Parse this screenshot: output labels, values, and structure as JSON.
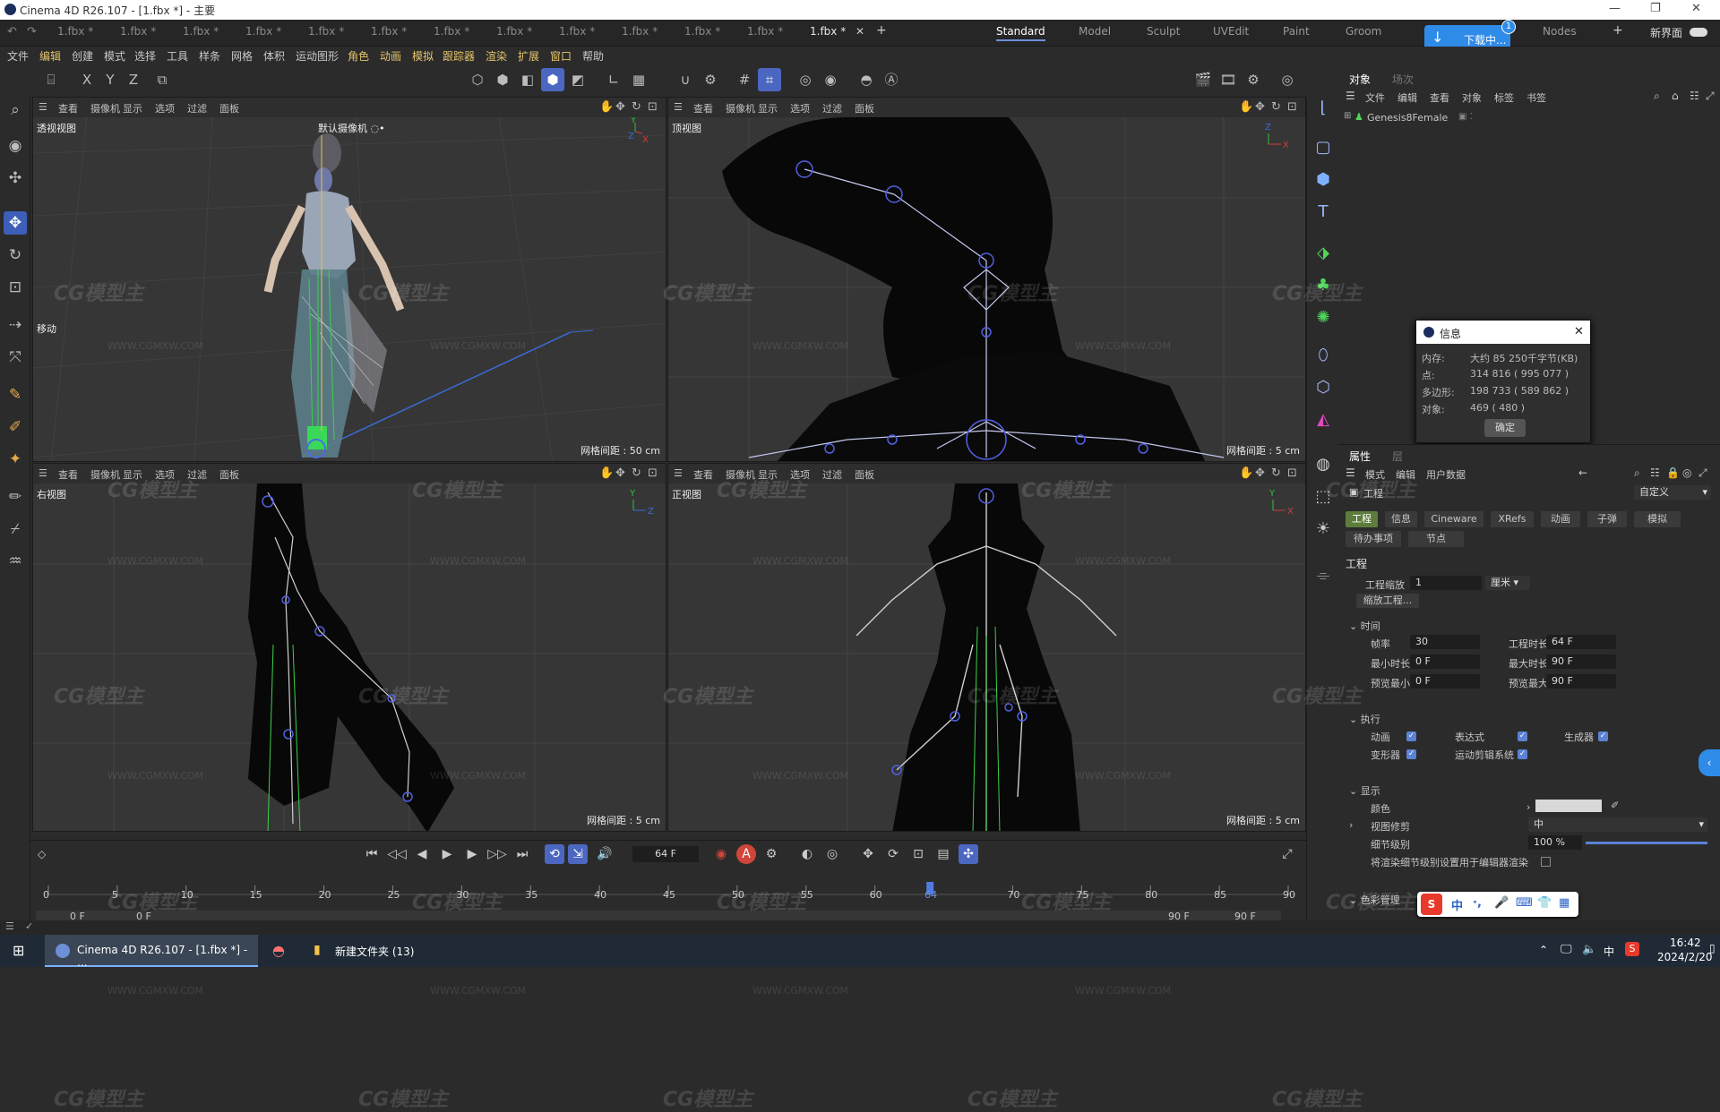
{
  "window": {
    "title": "Cinema 4D R26.107 - [1.fbx *] - 主要",
    "minimize": "—",
    "restore": "❐",
    "close": "✕"
  },
  "file_tabs": [
    "1.fbx *",
    "1.fbx *",
    "1.fbx *",
    "1.fbx *",
    "1.fbx *",
    "1.fbx *",
    "1.fbx *",
    "1.fbx *",
    "1.fbx *",
    "1.fbx *",
    "1.fbx *",
    "1.fbx *",
    "1.fbx *"
  ],
  "layouts": [
    "Standard",
    "Model",
    "Sculpt",
    "UVEdit",
    "Paint",
    "Groom",
    "Nodes"
  ],
  "new_layout": "新界面",
  "download": {
    "label": "下载中...",
    "badge": "1"
  },
  "menu": [
    "文件",
    "编辑",
    "创建",
    "模式",
    "选择",
    "工具",
    "样条",
    "网格",
    "体积",
    "运动图形",
    "角色",
    "动画",
    "模拟",
    "跟踪器",
    "渲染",
    "扩展",
    "窗口",
    "帮助"
  ],
  "axes": [
    "X",
    "Y",
    "Z"
  ],
  "viewport_menu": [
    "查看",
    "摄像机",
    "显示",
    "选项",
    "过滤",
    "面板"
  ],
  "viewports": {
    "perspective": {
      "name": "透视视图",
      "camera": "默认摄像机 ◌•",
      "grid": "网格间距 : 50 cm",
      "move_label": "移动"
    },
    "top": {
      "name": "顶视图",
      "grid": "网格间距 : 5 cm"
    },
    "right": {
      "name": "右视图",
      "grid": "网格间距 : 5 cm"
    },
    "front": {
      "name": "正视图",
      "grid": "网格间距 : 5 cm"
    }
  },
  "object_panel": {
    "tabs": [
      "对象",
      "场次"
    ],
    "menu": [
      "文件",
      "编辑",
      "查看",
      "对象",
      "标签",
      "书签"
    ],
    "object": "Genesis8Female"
  },
  "info_dialog": {
    "title": "信息",
    "rows": [
      {
        "label": "内存:",
        "value": "大约 85 250千字节(KB)"
      },
      {
        "label": "点:",
        "value": "314 816 ( 995 077 )"
      },
      {
        "label": "多边形:",
        "value": "198 733 ( 589 862 )"
      },
      {
        "label": "对象:",
        "value": "469 ( 480 )"
      }
    ],
    "ok": "确定"
  },
  "attr_panel": {
    "tabs": [
      "属性",
      "层"
    ],
    "menu": [
      "模式",
      "编辑",
      "用户数据"
    ],
    "header": "工程",
    "preset": "自定义",
    "subtabs": [
      "工程",
      "信息",
      "Cineware",
      "XRefs",
      "动画",
      "子弹",
      "模拟"
    ],
    "subtabs2": [
      "待办事项",
      "节点"
    ],
    "section": "工程",
    "project_scale_label": "工程缩放",
    "project_scale": "1",
    "project_scale_unit": "厘米",
    "scale_project_btn": "缩放工程...",
    "time_group": "时间",
    "fps_label": "帧率",
    "fps": "30",
    "project_time_label": "工程时长",
    "project_time": "64 F",
    "min_time_label": "最小时长",
    "min_time": "0 F",
    "max_time_label": "最大时长",
    "max_time": "90 F",
    "preview_min_label": "预览最小",
    "preview_min": "0 F",
    "preview_max_label": "预览最大",
    "preview_max": "90 F",
    "exec_group": "执行",
    "exec": [
      "动画",
      "表达式",
      "生成器",
      "变形器",
      "运动剪辑系统"
    ],
    "display_group": "显示",
    "color_label": "颜色",
    "lod_label": "视图修剪",
    "lod_value": "中",
    "detail_label": "细节级别",
    "detail_value": "100 %",
    "render_lod_label": "将渲染细节级别设置用于编辑器渲染",
    "color_mgmt_group": "色彩管理"
  },
  "timeline": {
    "current_frame": "64 F",
    "ticks": [
      "0",
      "5",
      "10",
      "15",
      "20",
      "25",
      "30",
      "35",
      "40",
      "45",
      "50",
      "55",
      "60",
      "64",
      "70",
      "75",
      "80",
      "85",
      "90"
    ],
    "start_a": "0 F",
    "start_b": "0 F",
    "end_a": "90 F",
    "end_b": "90 F",
    "playhead": 64,
    "max": 90
  },
  "taskbar": {
    "app1": "Cinema 4D R26.107 - [1.fbx *] - ...",
    "app2": "新建文件夹 (13)",
    "ime": "中",
    "time": "16:42",
    "date": "2024/2/20"
  },
  "ime_bar": [
    "中",
    "·,",
    "🎤",
    "⌨",
    "👕",
    "▦"
  ],
  "watermark": "CG模型主",
  "watermark_url": "WWW.CGMXW.COM"
}
